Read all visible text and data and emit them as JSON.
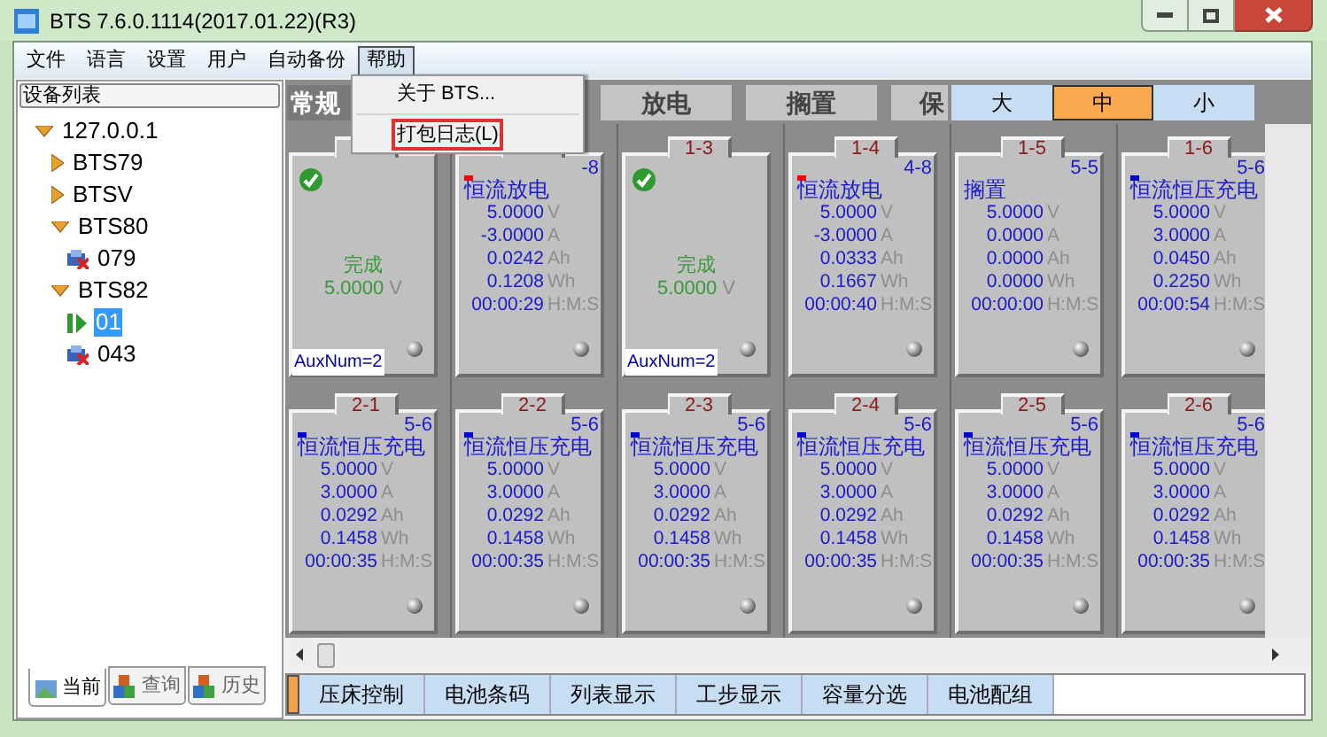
{
  "window": {
    "title": "BTS 7.6.0.1114(2017.01.22)(R3)"
  },
  "menu": [
    {
      "label": "文件",
      "selected": false
    },
    {
      "label": "语言",
      "selected": false
    },
    {
      "label": "设置",
      "selected": false
    },
    {
      "label": "用户",
      "selected": false
    },
    {
      "label": "自动备份",
      "selected": false
    },
    {
      "label": "帮助",
      "selected": true
    }
  ],
  "dropdown": [
    {
      "label": "关于 BTS...",
      "selected": false
    },
    {
      "label": "打包日志(L)",
      "selected": true
    }
  ],
  "device_list": {
    "title": "设备列表",
    "tree": [
      {
        "label": "127.0.0.1",
        "expanded": true,
        "selected": false,
        "children": [
          {
            "label": "BTS79",
            "expanded": false,
            "selected": false
          },
          {
            "label": "BTSV",
            "expanded": false,
            "selected": false
          },
          {
            "label": "BTS80",
            "expanded": true,
            "selected": false,
            "children": [
              {
                "label": "079",
                "kind": "device",
                "selected": false
              }
            ]
          },
          {
            "label": "BTS82",
            "expanded": true,
            "selected": false,
            "children": [
              {
                "label": "01",
                "kind": "running",
                "selected": true
              },
              {
                "label": "043",
                "kind": "device",
                "selected": false
              }
            ]
          }
        ]
      }
    ]
  },
  "left_tabs": [
    {
      "label": "当前",
      "selected": true
    },
    {
      "label": "查询",
      "selected": false
    },
    {
      "label": "历史",
      "selected": false
    }
  ],
  "view_tabs": [
    {
      "label": "常规",
      "selected": true
    },
    {
      "label": "放电",
      "selected": false
    },
    {
      "label": "搁置",
      "selected": false
    },
    {
      "label": "保",
      "selected": false
    }
  ],
  "size_buttons": [
    {
      "label": "大",
      "selected": false
    },
    {
      "label": "中",
      "selected": true
    },
    {
      "label": "小",
      "selected": false
    }
  ],
  "channels": [
    {
      "kind": "done",
      "state": "完成",
      "value": "5.0000",
      "unit": "V",
      "aux": "AuxNum=2"
    },
    {
      "kind": "running",
      "step": "-8",
      "color": "#ff0000",
      "name": "恒流放电",
      "readings": [
        {
          "value": "5.0000",
          "unit": "V"
        },
        {
          "value": "-3.0000",
          "unit": "A"
        },
        {
          "value": "0.0242",
          "unit": "Ah"
        },
        {
          "value": "0.1208",
          "unit": "Wh"
        },
        {
          "value": "00:00:29",
          "unit": "H:M:S"
        }
      ]
    },
    {
      "kind": "done",
      "label": "1-3",
      "state": "完成",
      "value": "5.0000",
      "unit": "V",
      "aux": "AuxNum=2"
    },
    {
      "kind": "running",
      "label": "1-4",
      "step": "4-8",
      "color": "#ff0000",
      "name": "恒流放电",
      "readings": [
        {
          "value": "5.0000",
          "unit": "V"
        },
        {
          "value": "-3.0000",
          "unit": "A"
        },
        {
          "value": "0.0333",
          "unit": "Ah"
        },
        {
          "value": "0.1667",
          "unit": "Wh"
        },
        {
          "value": "00:00:40",
          "unit": "H:M:S"
        }
      ]
    },
    {
      "kind": "running",
      "label": "1-5",
      "step": "5-5",
      "name": "搁置",
      "readings": [
        {
          "value": "5.0000",
          "unit": "V"
        },
        {
          "value": "0.0000",
          "unit": "A"
        },
        {
          "value": "0.0000",
          "unit": "Ah"
        },
        {
          "value": "0.0000",
          "unit": "Wh"
        },
        {
          "value": "00:00:00",
          "unit": "H:M:S"
        }
      ]
    },
    {
      "kind": "running",
      "label": "1-6",
      "step": "5-6",
      "color": "#0000cc",
      "name": "恒流恒压充电",
      "readings": [
        {
          "value": "5.0000",
          "unit": "V"
        },
        {
          "value": "3.0000",
          "unit": "A"
        },
        {
          "value": "0.0450",
          "unit": "Ah"
        },
        {
          "value": "0.2250",
          "unit": "Wh"
        },
        {
          "value": "00:00:54",
          "unit": "H:M:S"
        }
      ]
    },
    {
      "kind": "running",
      "label": "2-1",
      "step": "5-6",
      "color": "#0000cc",
      "name": "恒流恒压充电",
      "readings": [
        {
          "value": "5.0000",
          "unit": "V"
        },
        {
          "value": "3.0000",
          "unit": "A"
        },
        {
          "value": "0.0292",
          "unit": "Ah"
        },
        {
          "value": "0.1458",
          "unit": "Wh"
        },
        {
          "value": "00:00:35",
          "unit": "H:M:S"
        }
      ]
    },
    {
      "kind": "running",
      "label": "2-2",
      "step": "5-6",
      "color": "#0000cc",
      "name": "恒流恒压充电",
      "readings": [
        {
          "value": "5.0000",
          "unit": "V"
        },
        {
          "value": "3.0000",
          "unit": "A"
        },
        {
          "value": "0.0292",
          "unit": "Ah"
        },
        {
          "value": "0.1458",
          "unit": "Wh"
        },
        {
          "value": "00:00:35",
          "unit": "H:M:S"
        }
      ]
    },
    {
      "kind": "running",
      "label": "2-3",
      "step": "5-6",
      "color": "#0000cc",
      "name": "恒流恒压充电",
      "readings": [
        {
          "value": "5.0000",
          "unit": "V"
        },
        {
          "value": "3.0000",
          "unit": "A"
        },
        {
          "value": "0.0292",
          "unit": "Ah"
        },
        {
          "value": "0.1458",
          "unit": "Wh"
        },
        {
          "value": "00:00:35",
          "unit": "H:M:S"
        }
      ]
    },
    {
      "kind": "running",
      "label": "2-4",
      "step": "5-6",
      "color": "#0000cc",
      "name": "恒流恒压充电",
      "readings": [
        {
          "value": "5.0000",
          "unit": "V"
        },
        {
          "value": "3.0000",
          "unit": "A"
        },
        {
          "value": "0.0292",
          "unit": "Ah"
        },
        {
          "value": "0.1458",
          "unit": "Wh"
        },
        {
          "value": "00:00:35",
          "unit": "H:M:S"
        }
      ]
    },
    {
      "kind": "running",
      "label": "2-5",
      "step": "5-6",
      "color": "#0000cc",
      "name": "恒流恒压充电",
      "readings": [
        {
          "value": "5.0000",
          "unit": "V"
        },
        {
          "value": "3.0000",
          "unit": "A"
        },
        {
          "value": "0.0292",
          "unit": "Ah"
        },
        {
          "value": "0.1458",
          "unit": "Wh"
        },
        {
          "value": "00:00:35",
          "unit": "H:M:S"
        }
      ]
    },
    {
      "kind": "running",
      "label": "2-6",
      "step": "5-6",
      "color": "#0000cc",
      "name": "恒流恒压充电",
      "readings": [
        {
          "value": "5.0000",
          "unit": "V"
        },
        {
          "value": "3.0000",
          "unit": "A"
        },
        {
          "value": "0.0292",
          "unit": "Ah"
        },
        {
          "value": "0.1458",
          "unit": "Wh"
        },
        {
          "value": "00:00:35",
          "unit": "H:M:S"
        }
      ]
    }
  ],
  "bottom_tabs": [
    {
      "label": "压床控制"
    },
    {
      "label": "电池条码"
    },
    {
      "label": "列表显示"
    },
    {
      "label": "工步显示"
    },
    {
      "label": "容量分选"
    },
    {
      "label": "电池配组"
    }
  ]
}
